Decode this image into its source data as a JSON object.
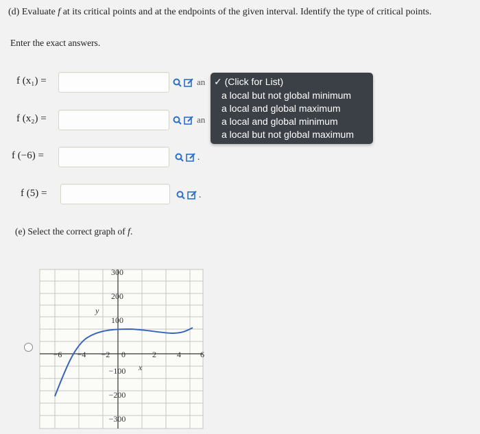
{
  "question": {
    "prefix": "(d) Evaluate ",
    "f": "f",
    "suffix": " at its critical points and at the endpoints of the given interval. Identify the type of critical points."
  },
  "instruction": "Enter the exact answers.",
  "rows": [
    {
      "label": "f (x₁) =",
      "value": "",
      "has_type": true,
      "type_text": "an"
    },
    {
      "label": "f (x₂) =",
      "value": "",
      "has_type": true,
      "type_text": "an"
    },
    {
      "label": "f (−6) =",
      "value": "",
      "has_type": false,
      "type_text": "."
    },
    {
      "label": "f (5) =",
      "value": "",
      "has_type": false,
      "type_text": "."
    }
  ],
  "dropdown": {
    "header": "✓ (Click for List)",
    "options": [
      "a local but not global minimum",
      "a local and global maximum",
      "a local and global minimum",
      "a local but not global maximum"
    ]
  },
  "section_e": {
    "prefix": "(e) Select the correct graph of ",
    "f": "f",
    "suffix": "."
  },
  "graph": {
    "x_ticks": [
      "−6",
      "−4",
      "−2",
      "0",
      "2",
      "4",
      "6"
    ],
    "y_ticks": [
      "300",
      "200",
      "100",
      "−100",
      "−200",
      "−300"
    ],
    "x_label": "x",
    "y_label": "y",
    "icon_colors": {
      "search": "#2b6fc7",
      "edit": "#2b6fc7"
    },
    "curve_color": "#3a64b8"
  }
}
